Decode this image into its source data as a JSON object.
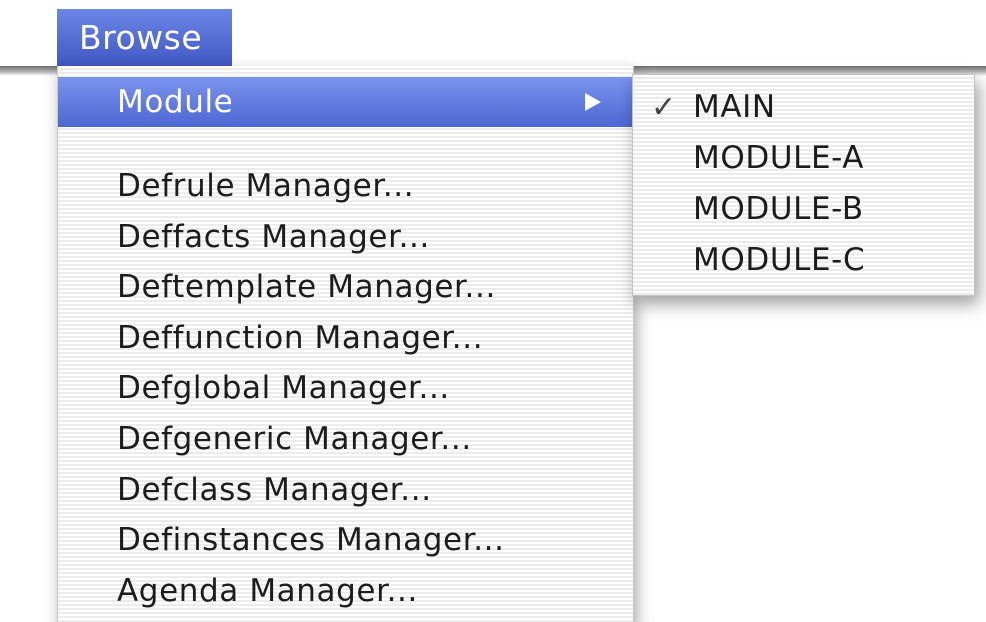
{
  "menubar": {
    "title": "Browse"
  },
  "menu": {
    "module_label": "Module",
    "items": [
      {
        "label": "Defrule Manager..."
      },
      {
        "label": "Deffacts Manager..."
      },
      {
        "label": "Deftemplate Manager..."
      },
      {
        "label": "Deffunction Manager..."
      },
      {
        "label": "Defglobal Manager..."
      },
      {
        "label": "Defgeneric Manager..."
      },
      {
        "label": "Defclass Manager..."
      },
      {
        "label": "Definstances Manager..."
      },
      {
        "label": "Agenda Manager..."
      }
    ]
  },
  "submenu": {
    "checked_item": "MAIN",
    "check_glyph": "✓",
    "items": [
      {
        "label": "MAIN"
      },
      {
        "label": "MODULE-A"
      },
      {
        "label": "MODULE-B"
      },
      {
        "label": "MODULE-C"
      }
    ]
  },
  "colors": {
    "selection": "#4d67d2",
    "text": "#1c1c1c"
  }
}
